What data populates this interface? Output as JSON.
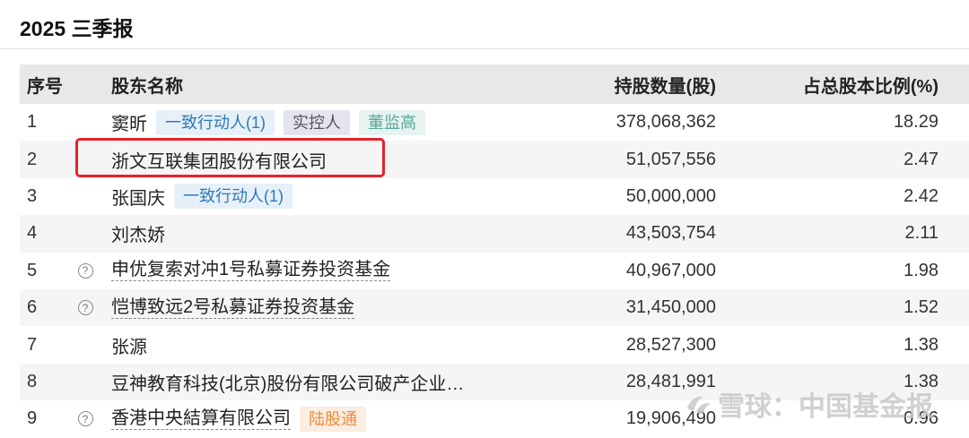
{
  "title": "2025 三季报",
  "columns": {
    "idx": "序号",
    "name": "股东名称",
    "shares": "持股数量(股)",
    "ratio": "占总股本比例(%)"
  },
  "rows": [
    {
      "idx": "1",
      "name": "窦昕",
      "tags": [
        "一致行动人(1)",
        "实控人",
        "董监高"
      ],
      "shares": "378,068,362",
      "ratio": "18.29"
    },
    {
      "idx": "2",
      "name": "浙文互联集团股份有限公司",
      "tags": [],
      "shares": "51,057,556",
      "ratio": "2.47"
    },
    {
      "idx": "3",
      "name": "张国庆",
      "tags": [
        "一致行动人(1)"
      ],
      "shares": "50,000,000",
      "ratio": "2.42"
    },
    {
      "idx": "4",
      "name": "刘杰娇",
      "tags": [],
      "shares": "43,503,754",
      "ratio": "2.11"
    },
    {
      "idx": "5",
      "name": "申优复索对冲1号私募证券投资基金",
      "tags": [],
      "shares": "40,967,000",
      "ratio": "1.98"
    },
    {
      "idx": "6",
      "name": "恺博致远2号私募证券投资基金",
      "tags": [],
      "shares": "31,450,000",
      "ratio": "1.52"
    },
    {
      "idx": "7",
      "name": "张源",
      "tags": [],
      "shares": "28,527,300",
      "ratio": "1.38"
    },
    {
      "idx": "8",
      "name": "豆神教育科技(北京)股份有限公司破产企业…",
      "tags": [],
      "shares": "28,481,991",
      "ratio": "1.38"
    },
    {
      "idx": "9",
      "name": "香港中央結算有限公司",
      "tags": [
        "陆股通"
      ],
      "shares": "19,906,490",
      "ratio": "0.96"
    }
  ],
  "help_icon_glyph": "?",
  "watermark": "雪球：中国基金报",
  "colors": {
    "highlight": "#e5222a",
    "tag_blue": "#2f79b8",
    "tag_orange": "#f08a3a"
  }
}
